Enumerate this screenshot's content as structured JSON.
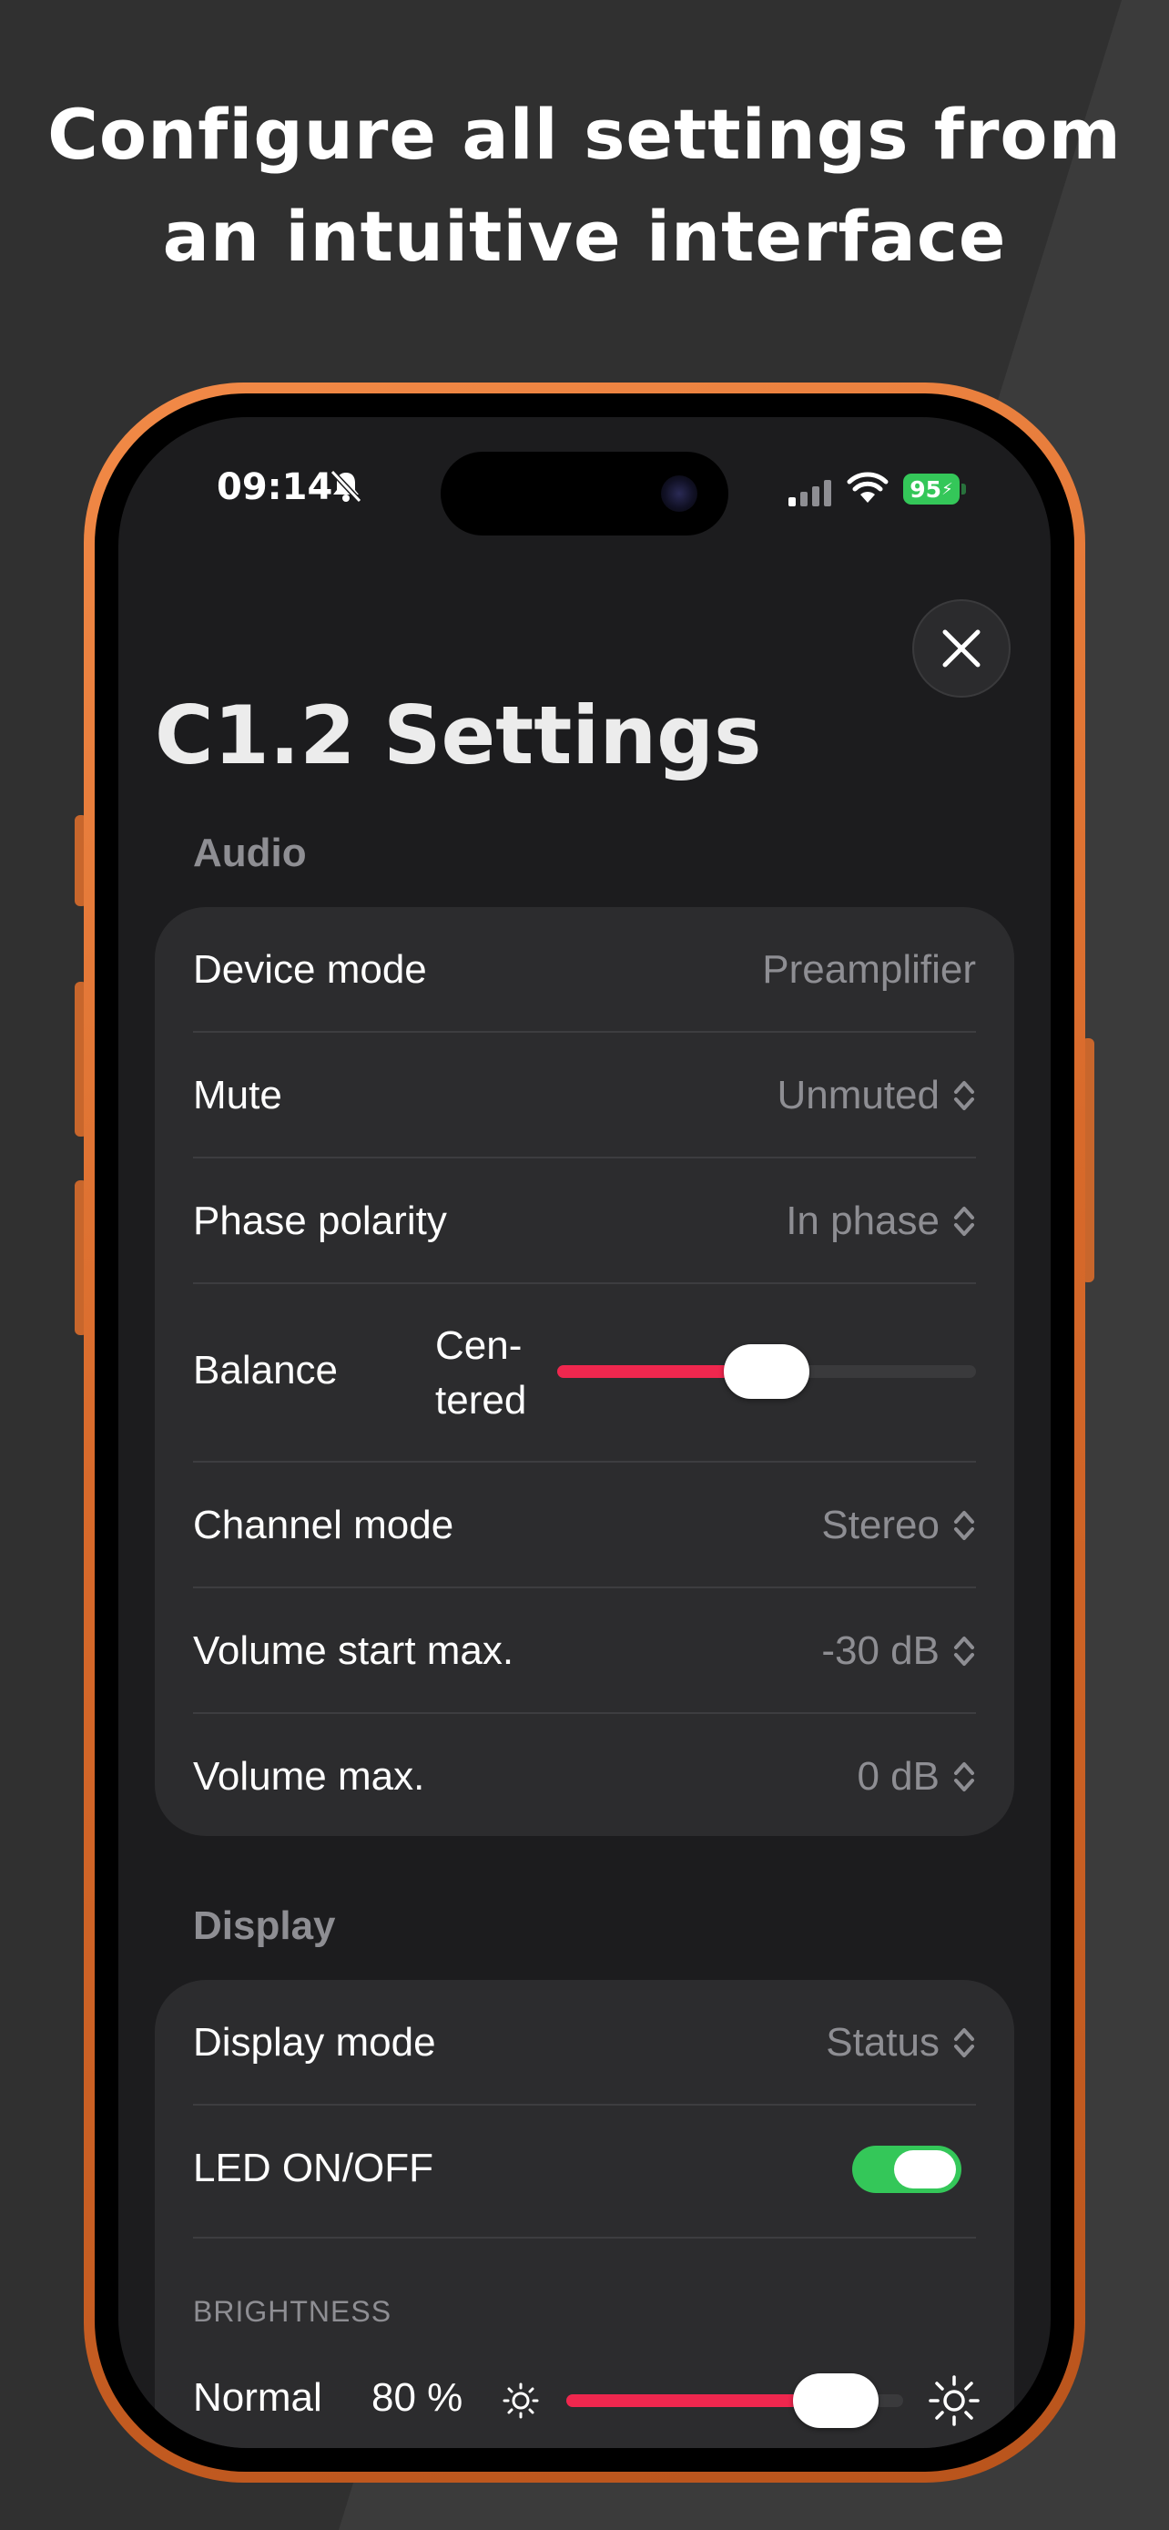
{
  "headline": {
    "line1": "Configure all settings from",
    "line2": "an intuitive interface"
  },
  "status_bar": {
    "time": "09:14",
    "battery": "95"
  },
  "page": {
    "title": "C1.2 Settings"
  },
  "audio": {
    "header": "Audio",
    "device_mode": {
      "label": "Device mode",
      "value": "Preamplifier"
    },
    "mute": {
      "label": "Mute",
      "value": "Unmuted"
    },
    "phase_polarity": {
      "label": "Phase polarity",
      "value": "In phase"
    },
    "balance": {
      "label": "Balance",
      "value_line1": "Cen-",
      "value_line2": "tered",
      "position": 0.5
    },
    "channel_mode": {
      "label": "Channel mode",
      "value": "Stereo"
    },
    "volume_start_max": {
      "label": "Volume start max.",
      "value": "-30 dB"
    },
    "volume_max": {
      "label": "Volume max.",
      "value": "0 dB"
    }
  },
  "display": {
    "header": "Display",
    "display_mode": {
      "label": "Display mode",
      "value": "Status"
    },
    "led": {
      "label": "LED ON/OFF",
      "on": true
    },
    "brightness": {
      "section_label": "BRIGHTNESS",
      "name": "Normal",
      "value": "80 %",
      "level": 0.8
    }
  },
  "colors": {
    "accent": "#f0274e",
    "toggle_on": "#34c759",
    "phone_frame": "#e0752f"
  },
  "icons": [
    "bell-slash-icon",
    "signal-icon",
    "wifi-icon",
    "battery-icon",
    "close-icon",
    "chevron-updown-icon",
    "sun-small-icon",
    "sun-large-icon"
  ]
}
